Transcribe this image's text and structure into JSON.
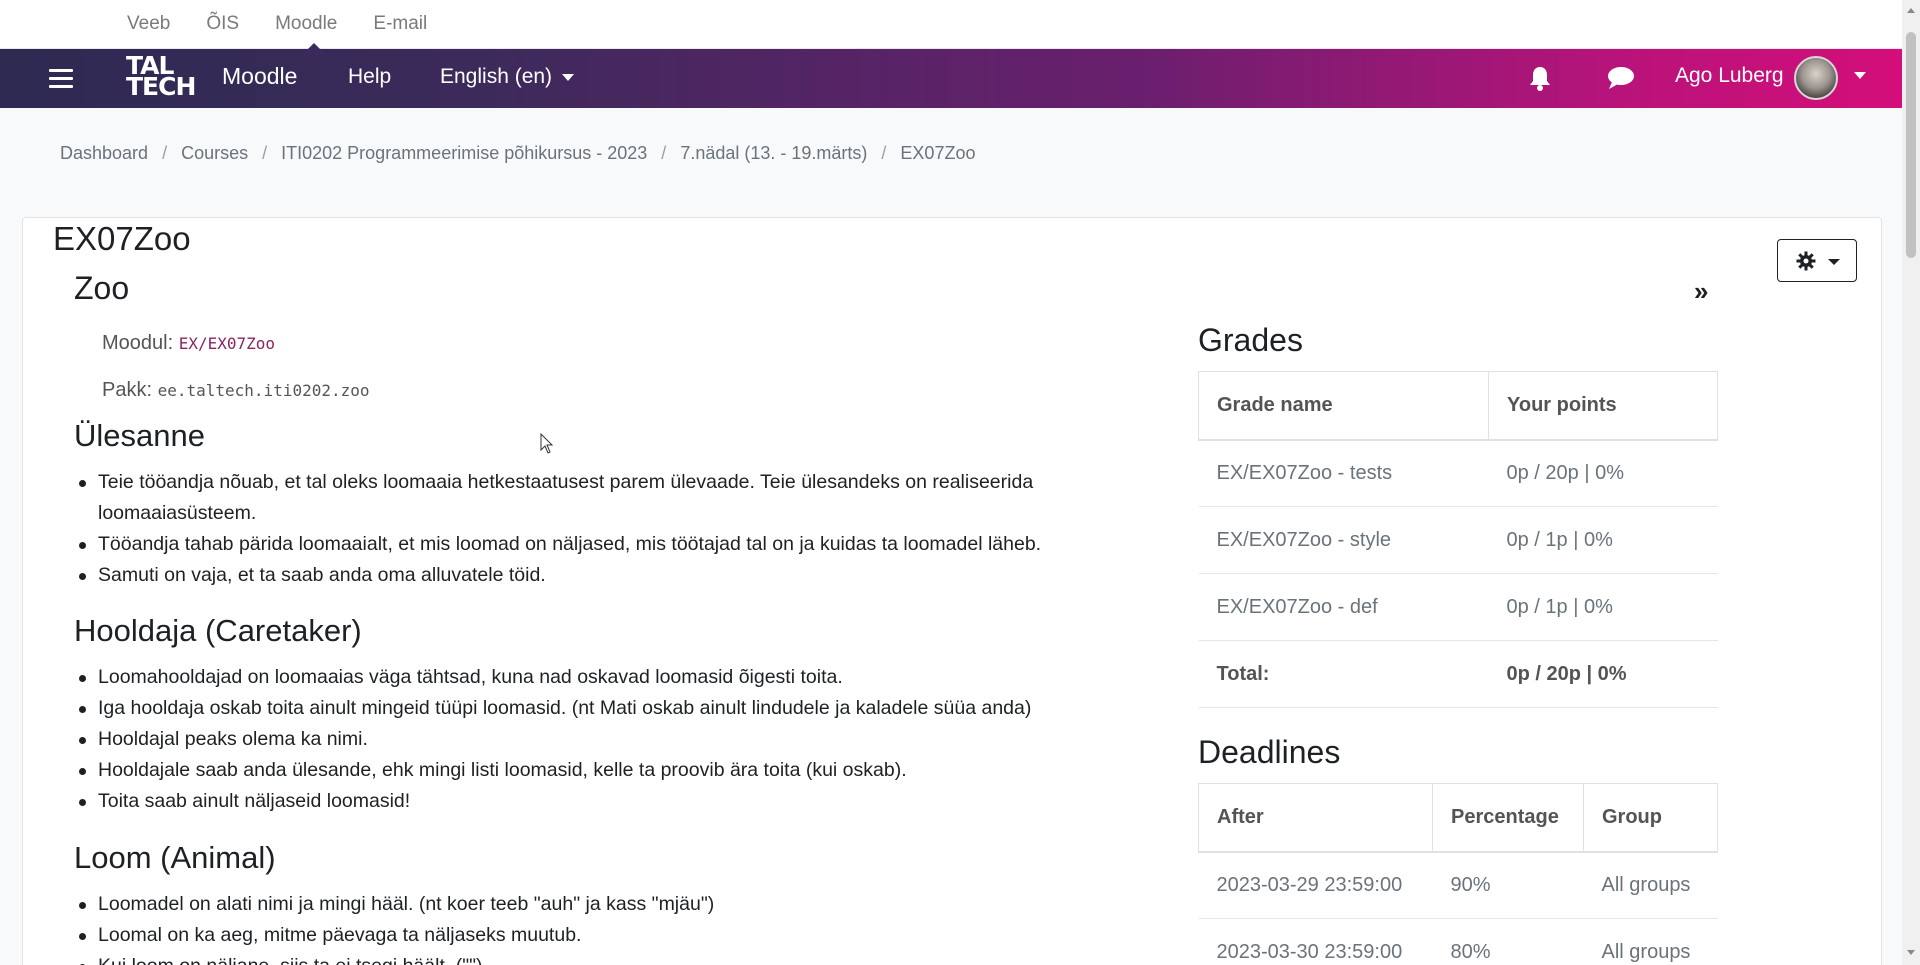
{
  "top_links": [
    "Veeb",
    "ÕIS",
    "Moodle",
    "E-mail"
  ],
  "navbar": {
    "logo_line1": "TAL",
    "logo_line2": "TECH",
    "moodle": "Moodle",
    "help": "Help",
    "language": "English (en)",
    "user_name": "Ago Luberg",
    "icons": [
      "menu-icon",
      "bell-icon",
      "chat-icon",
      "avatar"
    ]
  },
  "breadcrumb": [
    "Dashboard",
    "Courses",
    "ITI0202 Programmeerimise põhikursus - 2023",
    "7.nädal (13. - 19.märts)",
    "EX07Zoo"
  ],
  "page_title": "EX07Zoo",
  "collapse_label": "»",
  "content": {
    "heading": "Zoo",
    "module_label": "Moodul:",
    "module_value": "EX/EX07Zoo",
    "package_label": "Pakk:",
    "package_value": "ee.taltech.iti0202.zoo",
    "task_heading": "Ülesanne",
    "task_items": [
      "Teie tööandja nõuab, et tal oleks loomaaia hetkestaatusest parem ülevaade. Teie ülesandeks on realiseerida loomaaiasüsteem.",
      "Tööandja tahab pärida loomaaialt, et mis loomad on näljased, mis töötajad tal on ja kuidas ta loomadel läheb.",
      "Samuti on vaja, et ta saab anda oma alluvatele töid."
    ],
    "caretaker_heading": "Hooldaja (Caretaker)",
    "caretaker_items": [
      "Loomahooldajad on loomaaias väga tähtsad, kuna nad oskavad loomasid õigesti toita.",
      "Iga hooldaja oskab toita ainult mingeid tüüpi loomasid. (nt Mati oskab ainult lindudele ja kaladele süüa anda)",
      "Hooldajal peaks olema ka nimi.",
      "Hooldajale saab anda ülesande, ehk mingi listi loomasid, kelle ta proovib ära toita (kui oskab).",
      "Toita saab ainult näljaseid loomasid!"
    ],
    "animal_heading": "Loom (Animal)",
    "animal_items": [
      "Loomadel on alati nimi ja mingi hääl. (nt koer teeb \"auh\" ja kass \"mjäu\")",
      "Loomal on ka aeg, mitme päevaga ta näljaseks muutub.",
      "Kui loom on näljane, siis ta ei tsegi häält. (\"\")"
    ]
  },
  "grades": {
    "title": "Grades",
    "headers": [
      "Grade name",
      "Your points"
    ],
    "rows": [
      [
        "EX/EX07Zoo - tests",
        "0p / 20p | 0%"
      ],
      [
        "EX/EX07Zoo - style",
        "0p / 1p | 0%"
      ],
      [
        "EX/EX07Zoo - def",
        "0p / 1p | 0%"
      ]
    ],
    "total_label": "Total:",
    "total_value": "0p / 20p | 0%"
  },
  "deadlines": {
    "title": "Deadlines",
    "headers": [
      "After",
      "Percentage",
      "Group"
    ],
    "rows": [
      [
        "2023-03-29 23:59:00",
        "90%",
        "All groups"
      ],
      [
        "2023-03-30 23:59:00",
        "80%",
        "All groups"
      ]
    ]
  }
}
